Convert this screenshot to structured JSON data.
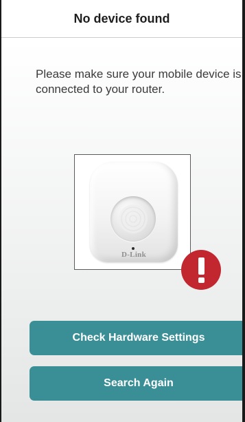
{
  "header": {
    "title": "No device found"
  },
  "message": {
    "text": "Please make sure your mobile device is connected to your router."
  },
  "device": {
    "icon": "motion-sensor-image",
    "brand": "D-Link"
  },
  "alert": {
    "icon": "exclamation-icon",
    "color": "#c2262f"
  },
  "actions": {
    "check_hardware_label": "Check Hardware Settings",
    "search_again_label": "Search Again",
    "button_color": "#3a8f97"
  }
}
